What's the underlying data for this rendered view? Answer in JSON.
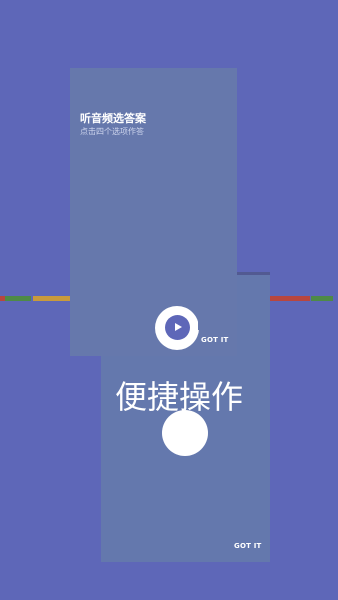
{
  "colors": {
    "background": "#5e67b8",
    "card": "#6678ac",
    "bar_green": "#4e8a47",
    "bar_orange": "#c99a3c",
    "bar_red": "#b8463f"
  },
  "tip_top": {
    "title": "听音频选答案",
    "subtitle": "点击四个选项作答",
    "button": "GOT IT",
    "icon": "play-icon"
  },
  "tip_bottom": {
    "title": "便捷操作",
    "button": "GOT IT"
  }
}
